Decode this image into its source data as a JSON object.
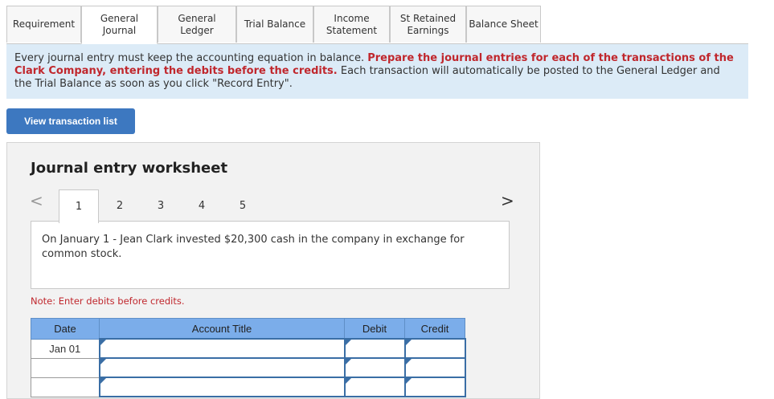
{
  "tabs": [
    {
      "label": "Requirement"
    },
    {
      "label": "General\nJournal"
    },
    {
      "label": "General\nLedger"
    },
    {
      "label": "Trial Balance"
    },
    {
      "label": "Income\nStatement"
    },
    {
      "label": "St Retained\nEarnings"
    },
    {
      "label": "Balance Sheet"
    }
  ],
  "active_tab": "General Journal",
  "banner": {
    "part1": "Every journal entry must keep the accounting equation in balance. ",
    "part2_red": "Prepare the journal entries for each of the transactions of the Clark Company, entering the debits before the credits.",
    "part3": " Each transaction will automatically be posted to the General Ledger and the Trial Balance as soon as you click \"Record Entry\"."
  },
  "view_button": "View transaction list",
  "worksheet": {
    "title": "Journal entry worksheet",
    "prev_arrow": "<",
    "next_arrow": ">",
    "pages": [
      "1",
      "2",
      "3",
      "4",
      "5"
    ],
    "active_page": "1",
    "description": "On January 1 - Jean Clark invested $20,300 cash in the company in exchange for common stock.",
    "note": "Note: Enter debits before credits.",
    "columns": {
      "date": "Date",
      "account": "Account Title",
      "debit": "Debit",
      "credit": "Credit"
    },
    "rows": [
      {
        "date": "Jan 01",
        "account": "",
        "debit": "",
        "credit": ""
      },
      {
        "date": "",
        "account": "",
        "debit": "",
        "credit": ""
      },
      {
        "date": "",
        "account": "",
        "debit": "",
        "credit": ""
      }
    ]
  }
}
